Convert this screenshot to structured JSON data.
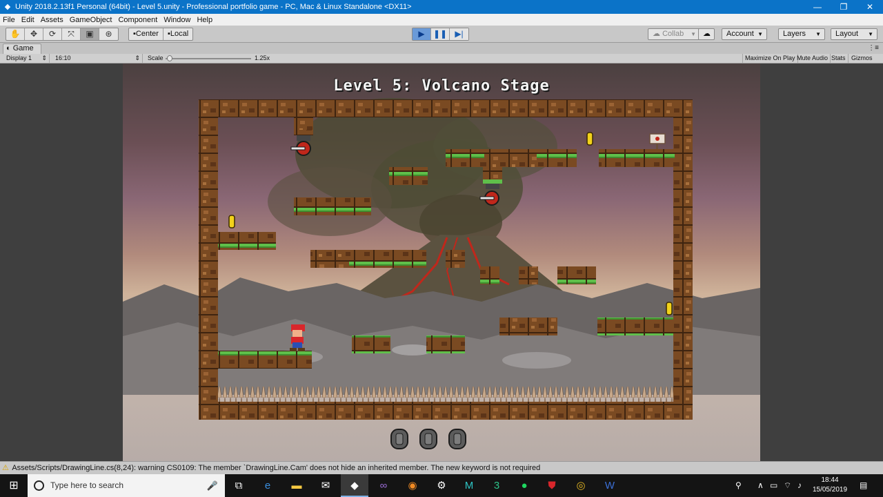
{
  "window": {
    "title": "Unity 2018.2.13f1 Personal (64bit) - Level 5.unity - Professional portfolio game - PC, Mac & Linux Standalone <DX11>",
    "minimize": "—",
    "maximize": "❐",
    "close": "✕"
  },
  "menu": [
    "File",
    "Edit",
    "Assets",
    "GameObject",
    "Component",
    "Window",
    "Help"
  ],
  "toolbar": {
    "pivot": "Center",
    "space": "Local",
    "collab": "Collab",
    "account": "Account",
    "layers": "Layers",
    "layout": "Layout"
  },
  "game_tab": {
    "label": "Game",
    "display": "Display 1",
    "aspect": "16:10",
    "scale_label": "Scale",
    "scale_value": "1.25x",
    "scale_fraction": 0.05,
    "maximize_on_play": "Maximize On Play",
    "mute_audio": "Mute Audio",
    "stats": "Stats",
    "gizmos": "Gizmos"
  },
  "game": {
    "title": "Level 5: Volcano Stage"
  },
  "status": {
    "message": "Assets/Scripts/DrawingLine.cs(8,24): warning CS0109: The member `DrawingLine.Cam' does not hide an inherited member. The new keyword is not required"
  },
  "taskbar": {
    "search_placeholder": "Type here to search",
    "time": "18:44",
    "date": "15/05/2019"
  },
  "colors": {
    "title_bar": "#0b73c8",
    "play_active": "#6a9ad8",
    "dirt": "#7a4a22",
    "grass": "#5fbf4a",
    "lava": "#c0271b"
  }
}
